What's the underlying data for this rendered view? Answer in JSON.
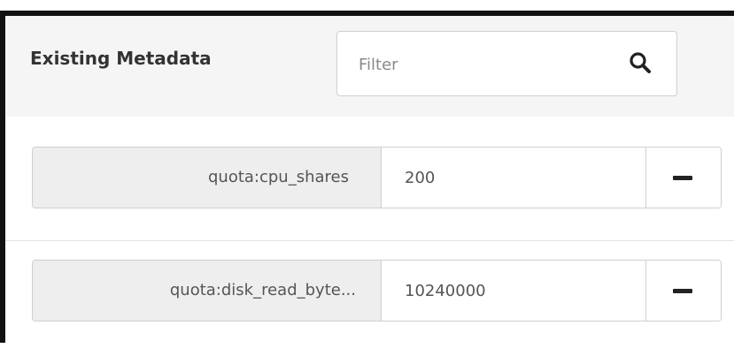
{
  "header": {
    "title": "Existing Metadata",
    "filter_placeholder": "Filter"
  },
  "icons": {
    "search": "search-icon",
    "remove": "minus-icon"
  },
  "rows": [
    {
      "key": "quota:cpu_shares",
      "value": "200"
    },
    {
      "key": "quota:disk_read_byte...",
      "value": "10240000"
    }
  ]
}
